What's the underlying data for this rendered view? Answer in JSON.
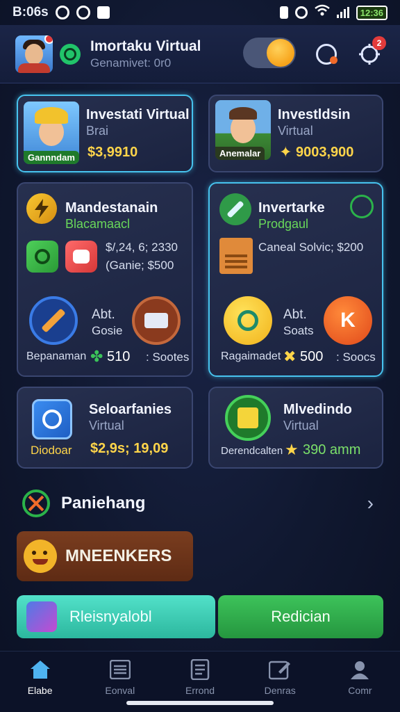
{
  "status_bar": {
    "left_text": "B:06s",
    "battery": "12:36"
  },
  "header": {
    "title": "Imortaku Virtual",
    "subtitle": "Genamivet: 0r0",
    "notification_count": "2"
  },
  "cards": [
    {
      "title": "Investati Virtual",
      "sub": "Brai",
      "portrait_tag": "Gannndam",
      "value": "$3,9910"
    },
    {
      "title": "Investldsin",
      "sub": "Virtual",
      "portrait_tag": "Anemalar",
      "value": "9003,900"
    },
    {
      "title": "Mandestanain",
      "sub": "Blacamaacl",
      "stat1": "$/,24, 6; 2330",
      "stat2": "(Ganie; $500",
      "circle_title": "Abt.",
      "circle_sub": "Gosie",
      "footer_label": "Bepanaman",
      "footer_value": "510",
      "footer_extra": ": Sootes"
    },
    {
      "title": "Invertarke",
      "sub": "Prodgaul",
      "stat1": "Caneal Solvic; $200",
      "circle_title": "Abt.",
      "circle_sub": "Soats",
      "footer_label": "Ragaimadet",
      "footer_value": "500",
      "footer_extra": ": Soocs"
    },
    {
      "title": "Seloarfanies",
      "sub": "Virtual",
      "footer_label": "Diodoar",
      "footer_value": "$2,9s; 19,09"
    },
    {
      "title": "Mlvedindo",
      "sub": "Virtual",
      "footer_label": "Derendcalten",
      "footer_value": "390 amm"
    }
  ],
  "row_item": {
    "label": "Paniehang"
  },
  "banner": {
    "label": "MNEENKERS"
  },
  "buttons": {
    "left": "Rleisnyalobl",
    "right": "Redician"
  },
  "nav": [
    {
      "label": "Elabe"
    },
    {
      "label": "Eonval"
    },
    {
      "label": "Errond"
    },
    {
      "label": "Denras"
    },
    {
      "label": "Comr"
    }
  ]
}
